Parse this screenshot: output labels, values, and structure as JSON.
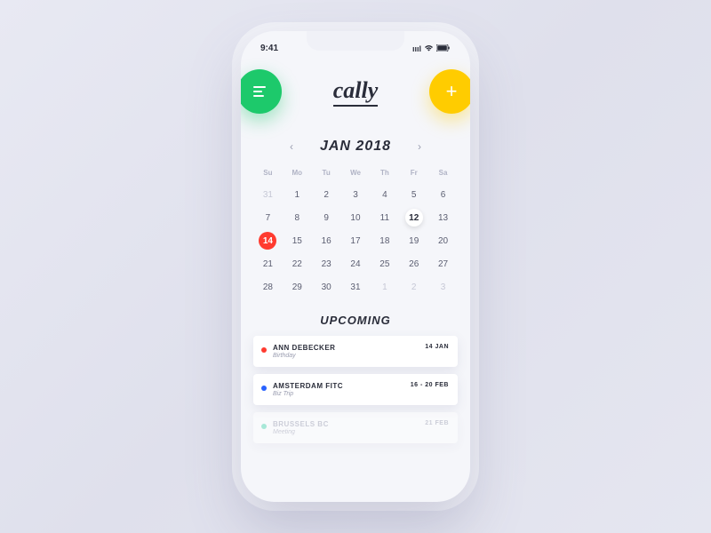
{
  "status": {
    "time": "9:41",
    "signal": "●●●●",
    "wifi": "▲",
    "battery": "■"
  },
  "app": {
    "name": "cally"
  },
  "header": {
    "menu_icon": "menu",
    "add_icon": "plus"
  },
  "calendar": {
    "prev_icon": "‹",
    "next_icon": "›",
    "month_label": "JAN 2018",
    "weekdays": [
      "Su",
      "Mo",
      "Tu",
      "We",
      "Th",
      "Fr",
      "Sa"
    ],
    "days": [
      {
        "n": "31",
        "faded": true
      },
      {
        "n": "1"
      },
      {
        "n": "2"
      },
      {
        "n": "3"
      },
      {
        "n": "4"
      },
      {
        "n": "5"
      },
      {
        "n": "6"
      },
      {
        "n": "7"
      },
      {
        "n": "8"
      },
      {
        "n": "9"
      },
      {
        "n": "10"
      },
      {
        "n": "11"
      },
      {
        "n": "12",
        "selected": true
      },
      {
        "n": "13"
      },
      {
        "n": "14",
        "marked": true
      },
      {
        "n": "15"
      },
      {
        "n": "16"
      },
      {
        "n": "17"
      },
      {
        "n": "18"
      },
      {
        "n": "19"
      },
      {
        "n": "20"
      },
      {
        "n": "21"
      },
      {
        "n": "22"
      },
      {
        "n": "23"
      },
      {
        "n": "24"
      },
      {
        "n": "25"
      },
      {
        "n": "26"
      },
      {
        "n": "27"
      },
      {
        "n": "28"
      },
      {
        "n": "29"
      },
      {
        "n": "30"
      },
      {
        "n": "31"
      },
      {
        "n": "1",
        "faded": true
      },
      {
        "n": "2",
        "faded": true
      },
      {
        "n": "3",
        "faded": true
      }
    ]
  },
  "upcoming": {
    "title": "UPCOMING",
    "events": [
      {
        "name": "ANN DEBECKER",
        "type": "Birthday",
        "date": "14 JAN",
        "color": "#ff3b30",
        "faded": false
      },
      {
        "name": "AMSTERDAM FITC",
        "type": "Biz Trip",
        "date": "16 - 20 FEB",
        "color": "#2962ff",
        "faded": false
      },
      {
        "name": "BRUSSELS BC",
        "type": "Meeting",
        "date": "21 FEB",
        "color": "#4dd9b0",
        "faded": true
      }
    ]
  },
  "colors": {
    "green": "#1dc96b",
    "yellow": "#ffcc00",
    "red": "#ff3b30",
    "blue": "#2962ff",
    "teal": "#4dd9b0"
  }
}
